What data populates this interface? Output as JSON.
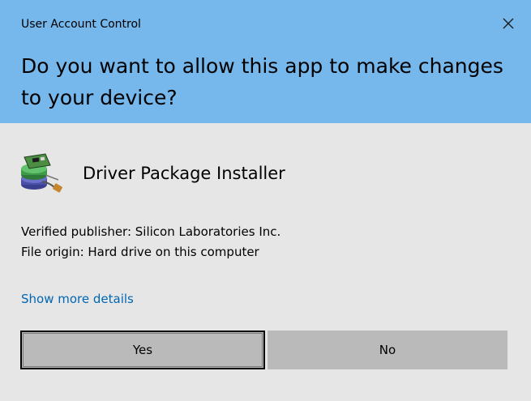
{
  "window": {
    "title": "User Account Control",
    "close_icon": "close-icon"
  },
  "prompt": {
    "question": "Do you want to allow this app to make changes to your device?"
  },
  "app": {
    "icon": "driver-package-installer-icon",
    "name": "Driver Package Installer"
  },
  "info": {
    "publisher": "Verified publisher: Silicon Laboratories Inc.",
    "origin": "File origin: Hard drive on this computer"
  },
  "details_link": "Show more details",
  "buttons": {
    "yes": "Yes",
    "no": "No"
  },
  "colors": {
    "header_bg": "#76b8ec",
    "body_bg": "#e6e6e6",
    "button_bg": "#bababa",
    "link": "#0066b4"
  }
}
